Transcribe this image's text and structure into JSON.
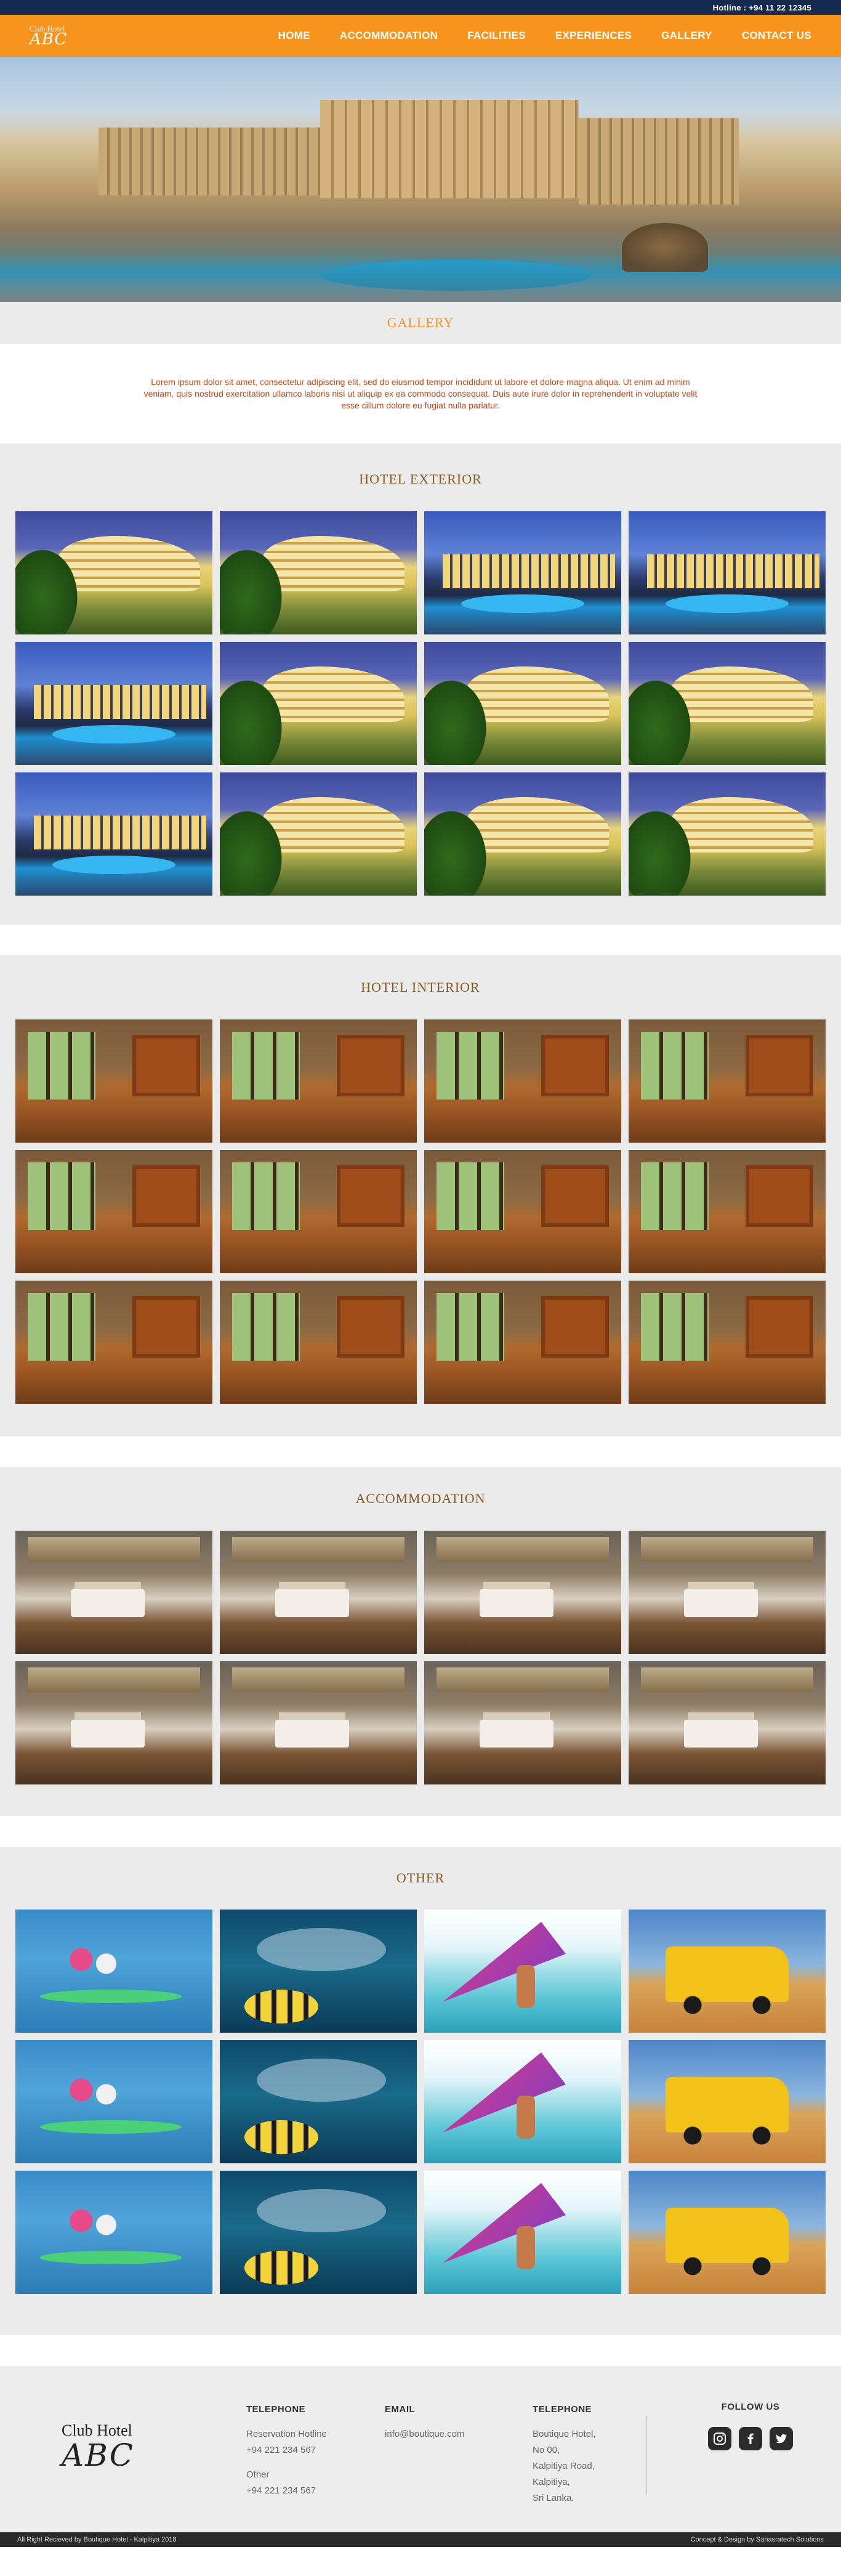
{
  "topbar": {
    "hotline": "Hotline : +94 11 22 12345"
  },
  "logo": {
    "line1": "Club Hotel",
    "line2": "ABC"
  },
  "nav": {
    "items": [
      {
        "label": "HOME"
      },
      {
        "label": "ACCOMMODATION"
      },
      {
        "label": "FACILITIES"
      },
      {
        "label": "EXPERIENCES"
      },
      {
        "label": "GALLERY",
        "active": true
      },
      {
        "label": "CONTACT US"
      }
    ]
  },
  "page": {
    "title": "GALLERY",
    "intro": "Lorem ipsum dolor sit amet, consectetur adipiscing elit, sed do eiusmod tempor incididunt ut labore et dolore magna aliqua. Ut enim ad minim veniam, quis nostrud exercitation ullamco laboris nisi ut aliquip ex ea commodo consequat. Duis aute irure dolor in reprehenderit in voluptate velit esse cillum dolore eu fugiat nulla pariatur."
  },
  "sections": {
    "exterior": {
      "title": "HOTEL EXTERIOR"
    },
    "interior": {
      "title": "HOTEL INTERIOR"
    },
    "accommodation": {
      "title": "ACCOMMODATION"
    },
    "other": {
      "title": "OTHER"
    }
  },
  "footer": {
    "logo": {
      "line1": "Club Hotel",
      "line2": "ABC"
    },
    "telephone": {
      "heading": "TELEPHONE",
      "line1": "Reservation Hotline",
      "line2": "+94 221 234 567",
      "line3": "Other",
      "line4": "+94 221 234 567"
    },
    "email": {
      "heading": "EMAIL",
      "value": "info@boutique.com"
    },
    "address": {
      "heading": "TELEPHONE",
      "line1": "Boutique Hotel,",
      "line2": "No 00,",
      "line3": "Kalpitiya Road,",
      "line4": "Kalpitiya,",
      "line5": "Sri Lanka."
    },
    "follow": {
      "heading": "FOLLOW US",
      "icons": [
        "instagram-icon",
        "facebook-icon",
        "twitter-icon"
      ]
    }
  },
  "bottombar": {
    "rights": "All Right Recieved by Boutique Hotel - Kalpitiya 2018",
    "credit": "Concept & Design by Sahasratech Solutions"
  },
  "colors": {
    "accent": "#f7941d",
    "navy": "#152a4e",
    "section_bg": "#ebebeb",
    "heading_brown": "#8a5a22",
    "intro_text": "#c7451a"
  }
}
